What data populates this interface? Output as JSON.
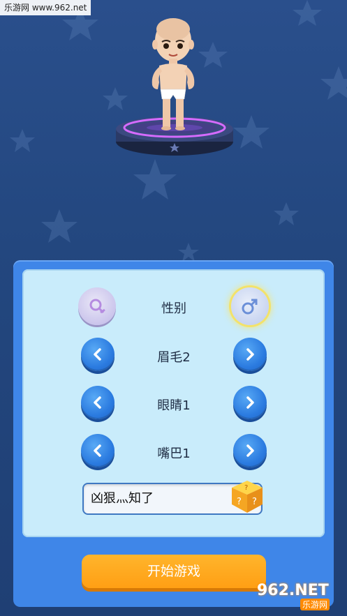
{
  "watermark_top": "乐游网 www.962.net",
  "character": {
    "gender_label": "性别"
  },
  "customizer": {
    "rows": [
      {
        "label": "眉毛2"
      },
      {
        "label": "眼睛1"
      },
      {
        "label": "嘴巴1"
      }
    ]
  },
  "name_input": {
    "value": "凶狠灬知了"
  },
  "start_button": {
    "label": "开始游戏"
  },
  "watermark_bottom": {
    "brand": "962.NET",
    "sub": "乐游网"
  },
  "colors": {
    "background": "#23477f",
    "panel": "#3f86e8",
    "panel_inner": "#c9ecfb",
    "button_blue": "#2b7be0",
    "start_orange": "#ff9f14"
  },
  "icons": [
    "female-gender-icon",
    "male-gender-icon",
    "chevron-left-icon",
    "chevron-right-icon",
    "dice-icon"
  ]
}
